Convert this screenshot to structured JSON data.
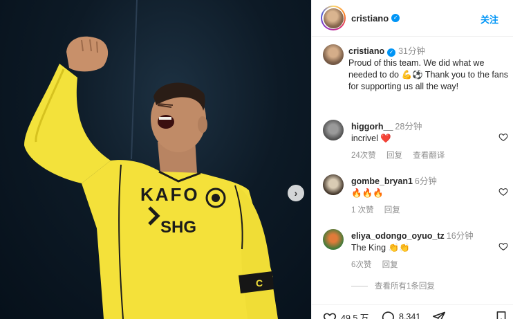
{
  "post": {
    "username": "cristiano",
    "follow_label": "关注"
  },
  "caption": {
    "username": "cristiano",
    "time": "31分钟",
    "text": "Proud of this team. We did what we needed to do 💪⚽ Thank you to the fans for supporting us all the way!"
  },
  "jersey": {
    "sponsor1": "KAFO",
    "sponsor2": "SHG",
    "armband": "C"
  },
  "comments": [
    {
      "username": "higgorh__",
      "time": "28分钟",
      "text": "incrivel ❤️",
      "likes": "24次赞",
      "reply": "回复",
      "translate": "查看翻译"
    },
    {
      "username": "gombe_bryan1",
      "time": "6分钟",
      "text": "🔥🔥🔥",
      "likes": "1 次赞",
      "reply": "回复"
    },
    {
      "username": "eliya_odongo_oyuo_tz",
      "time": "16分钟",
      "text": "The King 👏👏",
      "likes": "6次赞",
      "reply": "回复"
    }
  ],
  "view_replies": "查看所有1条回复",
  "stats": {
    "likes": "49.5 万",
    "comments": "8,341"
  },
  "colors": {
    "accent": "#0095f6",
    "jersey": "#f4e13a",
    "heart_filled": "#ed4956"
  }
}
